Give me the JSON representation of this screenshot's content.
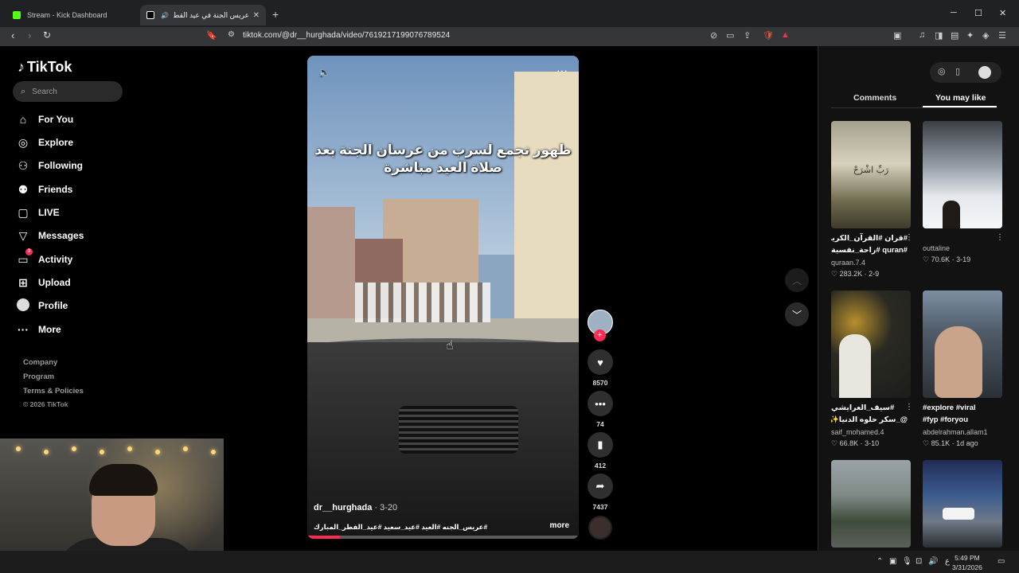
{
  "browser": {
    "tabs": [
      {
        "title": "Stream - Kick Dashboard",
        "fav_color": "#53fc18"
      },
      {
        "title": "عريس الجنة في عيد القطر المبا",
        "fav_color": "#ffffff"
      }
    ],
    "url": "tiktok.com/@dr__hurghada/video/7619217199076789524"
  },
  "sidebar": {
    "logo": "TikTok",
    "search_placeholder": "Search",
    "nav": [
      {
        "label": "For You",
        "icon": "home-icon"
      },
      {
        "label": "Explore",
        "icon": "compass-icon"
      },
      {
        "label": "Following",
        "icon": "following-icon"
      },
      {
        "label": "Friends",
        "icon": "friends-icon"
      },
      {
        "label": "LIVE",
        "icon": "live-icon"
      },
      {
        "label": "Messages",
        "icon": "messages-icon"
      },
      {
        "label": "Activity",
        "icon": "activity-icon",
        "badge": "3"
      },
      {
        "label": "Upload",
        "icon": "upload-icon"
      },
      {
        "label": "Profile",
        "icon": "avatar"
      },
      {
        "label": "More",
        "icon": "more-icon"
      }
    ],
    "footer": [
      "Company",
      "Program",
      "Terms & Policies",
      "© 2026 TikTok"
    ]
  },
  "video": {
    "caption_line1": "ظهور تجمع لسرب من عرسان الجنة بعد",
    "caption_line2": "صلاة العيد مباشرة",
    "author": "dr__hurghada",
    "date": " · 3-20",
    "tags": "#عريس_الجنه #العيد #عيد_سعيد #عيد_الفطر_المبارك",
    "more": "more",
    "progress": 0.12
  },
  "actions": {
    "likes": "8570",
    "comments": "74",
    "saves": "412",
    "shares": "7437"
  },
  "right_panel": {
    "tabs": [
      "Comments",
      "You may like"
    ],
    "active_tab": "You may like",
    "items": [
      {
        "desc1": "#قران #القرآن_الكريم",
        "desc2": "#quran #راحة_نفسية",
        "user": "quraan.7.4",
        "likes": "283.2K",
        "date": "2-9"
      },
      {
        "desc1": "",
        "desc2": "",
        "user": "outtaline",
        "likes": "70.6K",
        "date": "3-19"
      },
      {
        "desc1": "#سيف_العرايشي",
        "desc2": "@_سكر حلوه الدنيا✨",
        "user": "saif_mohamed.4",
        "likes": "66.8K",
        "date": "3-10"
      },
      {
        "desc1": "#explore #viral",
        "desc2": "#fyp #foryou",
        "user": "abdelrahman.allam1",
        "likes": "85.1K",
        "date": "1d ago"
      }
    ]
  },
  "taskbar": {
    "time": "5:49 PM",
    "date": "3/31/2026",
    "lang": "ع"
  },
  "colors": {
    "accent": "#fe2c55",
    "background": "#000000",
    "panel": "#121212"
  }
}
